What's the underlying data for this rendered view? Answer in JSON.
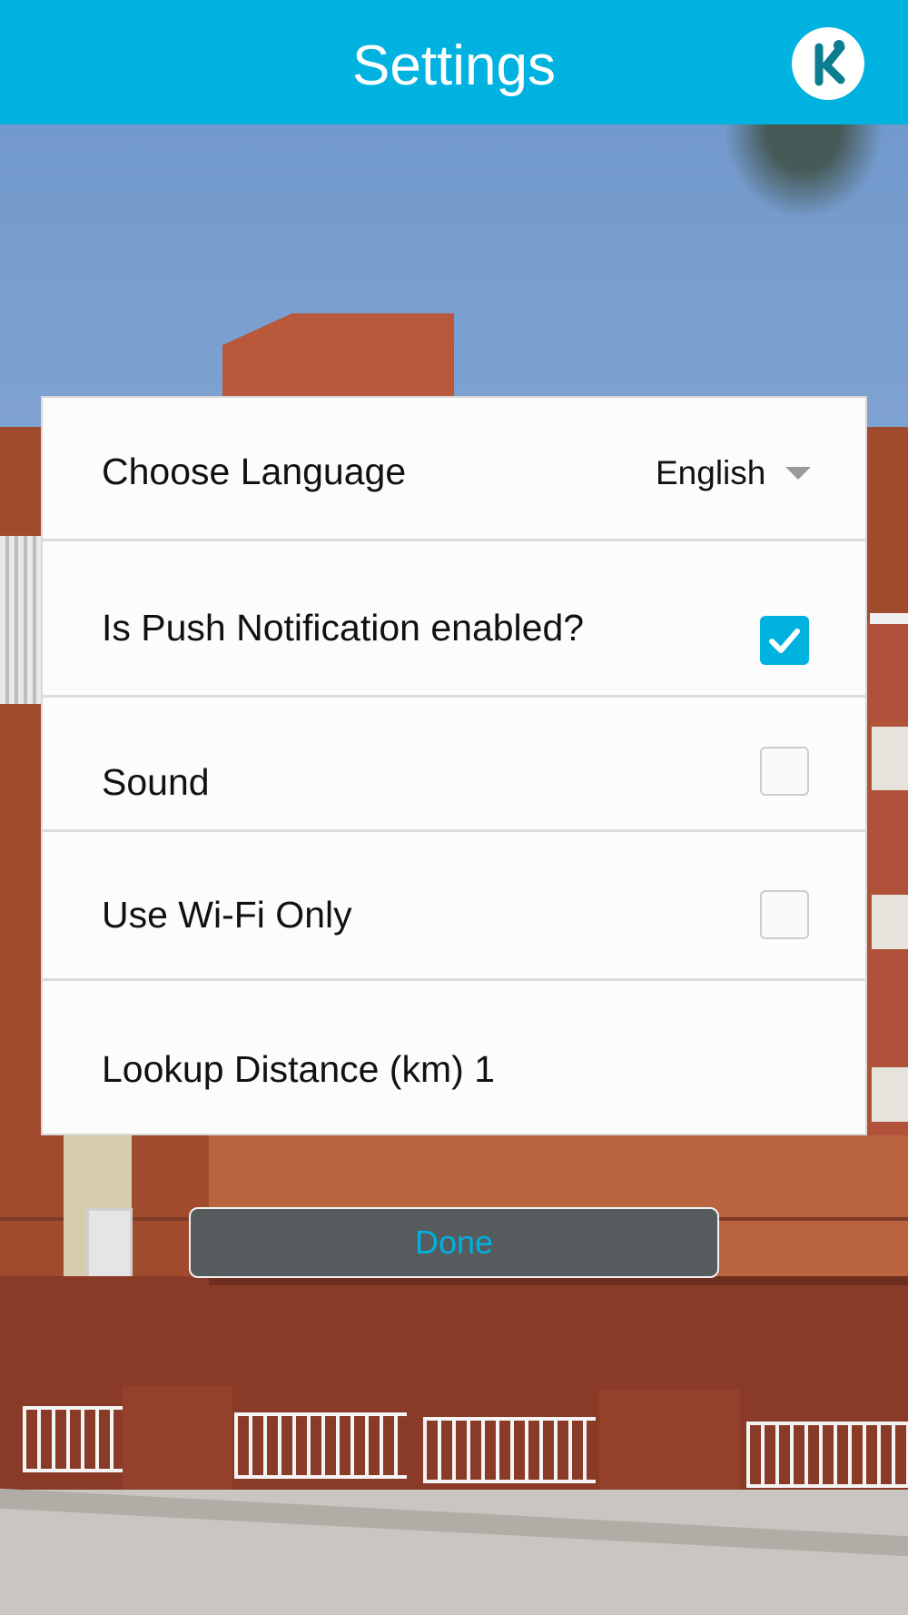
{
  "header": {
    "title": "Settings",
    "logo_icon": "kiddo-k-logo-icon"
  },
  "settings": {
    "language": {
      "label": "Choose Language",
      "value": "English",
      "icon": "caret-down-icon"
    },
    "push_notification": {
      "label": "Is Push Notification enabled?",
      "checked": true,
      "icon": "checkmark-icon"
    },
    "sound": {
      "label": "Sound",
      "checked": false
    },
    "wifi_only": {
      "label": "Use Wi-Fi Only",
      "checked": false
    },
    "lookup_distance": {
      "label": "Lookup Distance (km)",
      "value": "1"
    }
  },
  "actions": {
    "done_label": "Done"
  },
  "colors": {
    "accent": "#00b2df",
    "header_bg": "#00b2df",
    "done_bg": "#565b5e",
    "panel_bg": "#fcfcfc"
  }
}
